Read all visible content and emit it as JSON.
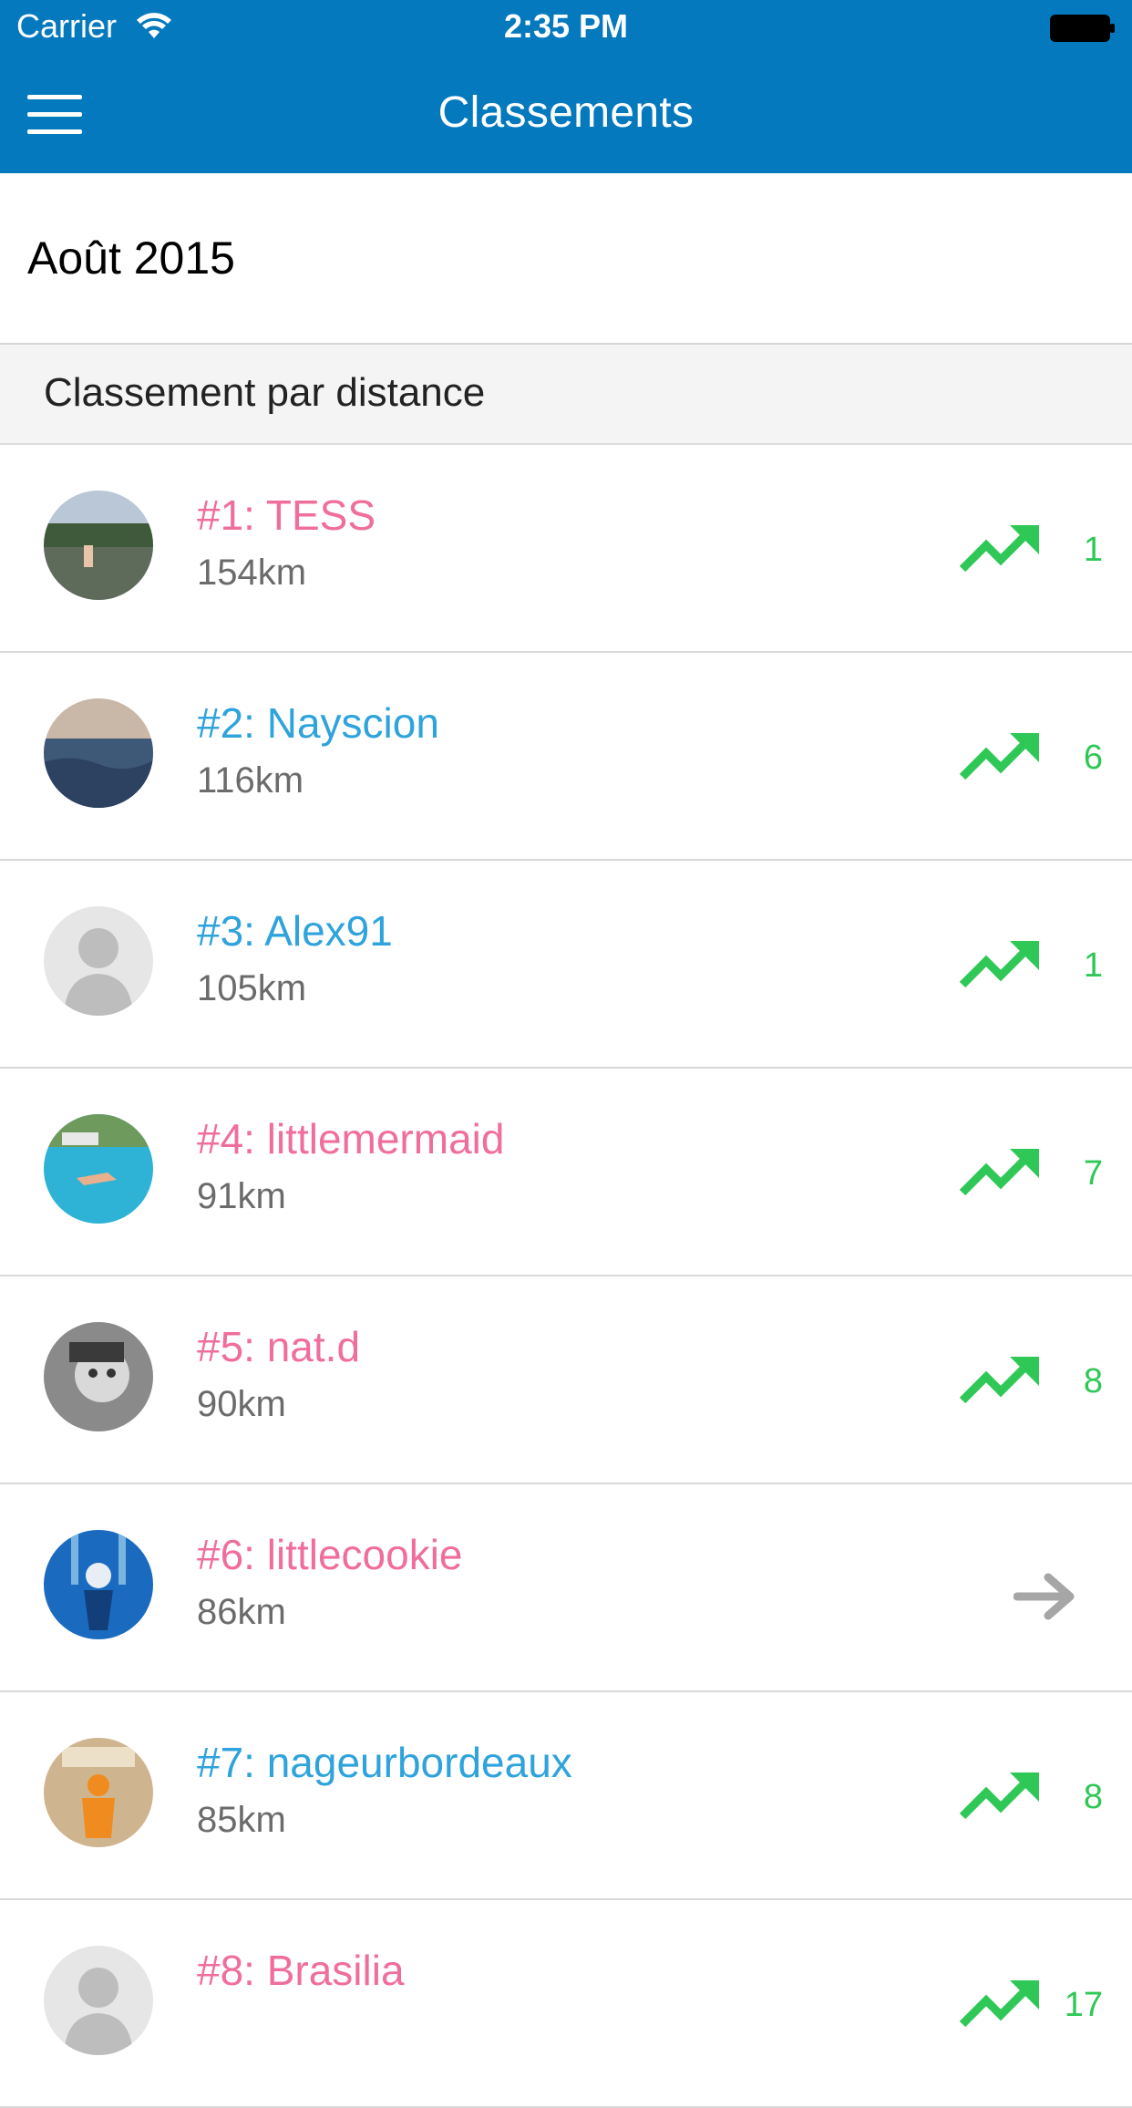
{
  "status_bar": {
    "carrier": "Carrier",
    "time": "2:35 PM"
  },
  "nav": {
    "title": "Classements"
  },
  "month": "Août 2015",
  "section": {
    "title": "Classement par distance"
  },
  "colors": {
    "header": "#0479bd",
    "pink": "#f06e9c",
    "blue": "#2fa3dc",
    "green": "#2fc857",
    "gray_arrow": "#a6a6a6"
  },
  "entries": [
    {
      "name": "#1: TESS",
      "distance": "154km",
      "color": "pink",
      "trend": "up",
      "change": "1",
      "avatar": "lake-photo"
    },
    {
      "name": "#2: Nayscion",
      "distance": "116km",
      "color": "blue",
      "trend": "up",
      "change": "6",
      "avatar": "sea-photo"
    },
    {
      "name": "#3: Alex91",
      "distance": "105km",
      "color": "blue",
      "trend": "up",
      "change": "1",
      "avatar": "default-silhouette"
    },
    {
      "name": "#4: littlemermaid",
      "distance": "91km",
      "color": "pink",
      "trend": "up",
      "change": "7",
      "avatar": "pool-photo"
    },
    {
      "name": "#5: nat.d",
      "distance": "90km",
      "color": "pink",
      "trend": "up",
      "change": "8",
      "avatar": "bw-portrait"
    },
    {
      "name": "#6: littlecookie",
      "distance": "86km",
      "color": "pink",
      "trend": "same",
      "change": "",
      "avatar": "underwater-photo"
    },
    {
      "name": "#7: nageurbordeaux",
      "distance": "85km",
      "color": "blue",
      "trend": "up",
      "change": "8",
      "avatar": "orange-figure"
    },
    {
      "name": "#8: Brasilia",
      "distance": "",
      "color": "pink",
      "trend": "up",
      "change": "17",
      "avatar": "default-silhouette"
    }
  ]
}
